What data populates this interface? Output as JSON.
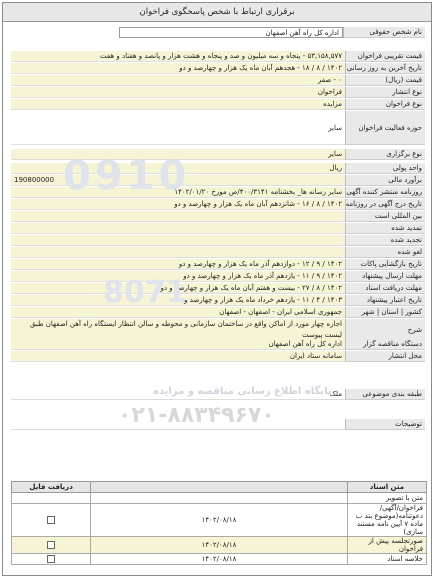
{
  "header": {
    "title": "برقراری ارتباط با شخص پاسخگوی فراخوان"
  },
  "person": {
    "label": "نام شخص حقوقی",
    "value": "اداره کل راه آهن اصفهان"
  },
  "fields": [
    {
      "label": "قیمت تقریبی فراخوان",
      "value": "۵۳,۱۵۸,۵۷۷ - پنجاه و سه میلیون و صد و پنجاه و هشت هزار و پانصد و هفتاد و هفت"
    },
    {
      "label": "تاریخ آخرین به روز رسانی",
      "value": "۱۴۰۲ / ۸ / ۱۸ - هجدهم آبان ماه یک هزار و چهارصد و دو"
    },
    {
      "label": "قیمت (ریال)",
      "value": "۰ - صفر"
    },
    {
      "label": "نوع انتشار",
      "value": "فراخوان"
    },
    {
      "label": "نوع فراخوان",
      "value": "مزایده"
    },
    {
      "label": "حوزه فعالیت فراخوان",
      "value": "سایر"
    },
    {
      "label": "نوع برگزاری",
      "value": "سایر"
    },
    {
      "label": "واحد پولی",
      "value": "ریال"
    },
    {
      "label": "برآورد مالی",
      "value": "190800000"
    },
    {
      "label": "روزنامه منتشر کننده آگهی",
      "value": "سایر رسانه ها_ بخشنامه ۴۰۰/۳۱۴۱/ص مورخ ۱۴۰۲/۰۱/۲۰"
    },
    {
      "label": "تاریخ درج آگهی در روزنامه",
      "value": "۱۴۰۲ / ۸ / ۱۶ - شانزدهم آبان ماه یک هزار و چهارصد و دو"
    },
    {
      "label": "بین المللی است",
      "value": ""
    },
    {
      "label": "تمدید شده",
      "value": ""
    },
    {
      "label": "تجدید شده",
      "value": ""
    },
    {
      "label": "لغو شده",
      "value": ""
    },
    {
      "label": "تاریخ بازگشایی پاکات",
      "value": "۱۴۰۲ / ۹ / ۱۲ - دوازدهم آذر ماه یک هزار و چهارصد و دو"
    },
    {
      "label": "مهلت ارسال پیشنهاد",
      "value": "۱۴۰۲ / ۹ / ۱۱ - یازدهم آذر ماه یک هزار و چهارصد و دو"
    },
    {
      "label": "مهلت دریافت اسناد",
      "value": "۱۴۰۲ / ۸ / ۲۷ - بیست و هفتم آبان ماه یک هزار و چهارصد و دو"
    },
    {
      "label": "تاریخ اعتبار پیشنهاد",
      "value": "۱۴۰۳ / ۴ / ۱۱ - یازدهم خرداد ماه یک هزار و چهارصد و سه"
    },
    {
      "label": "کشور | استان | شهر",
      "value": "جمهوری اسلامی ایران - اصفهان - اصفهان"
    },
    {
      "label": "شرح",
      "value": "اجاره چهار مورد از اماکن واقع در ساختمان سازمانی و محوطه و سالن انتظار ایستگاه راه آهن اصفهان طبق لیست پیوست"
    },
    {
      "label": "دستگاه مناقصه گزار",
      "value": "اداره کل راه آهن اصفهان"
    },
    {
      "label": "محل انتشار",
      "value": "سامانه ستاد ایران"
    },
    {
      "label": "طبقه بندی موضوعی",
      "value": "ملک"
    },
    {
      "label": "توضیحات",
      "value": ""
    }
  ],
  "watermark": {
    "phone": "۰۲۱-۸۸۳۴۹۶۷۰",
    "text": "پایگاه اطلاع رسانی مناقصه و مزایده"
  },
  "docs": {
    "headers": [
      "متن اسناد",
      "دریافت فایل"
    ],
    "rows": [
      {
        "text": "متن با تصویر",
        "date": ""
      },
      {
        "text": "فراخوان/آگهی/دعوتنامه(موضوع بند ب ماده ۷ آیین نامه مستند سازی)",
        "date": "۱۴۰۲/۰۸/۱۸"
      },
      {
        "text": "صورتجلسه پیش از فراخوان",
        "date": "۱۴۰۲/۰۸/۱۸"
      },
      {
        "text": "خلاصه اسناد",
        "date": "۱۴۰۲/۰۸/۱۸"
      }
    ]
  }
}
